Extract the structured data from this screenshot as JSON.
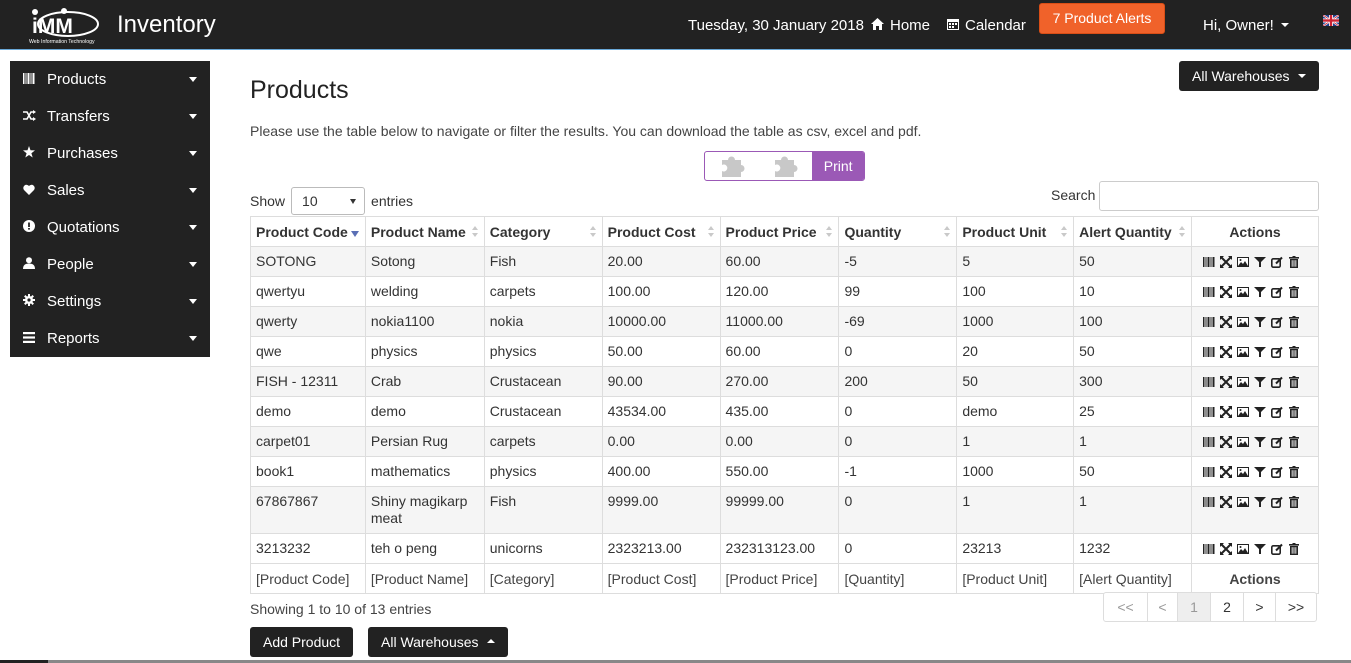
{
  "header": {
    "logo_text": "iMM",
    "logo_subtext": "Web Information Technology",
    "brand": "Inventory",
    "date": "Tuesday, 30 January 2018",
    "home_label": "Home",
    "calendar_label": "Calendar",
    "alerts_label": "7 Product Alerts",
    "user_label": "Hi, Owner!",
    "accent": "#f0622a"
  },
  "sidebar": {
    "items": [
      {
        "label": "Products",
        "icon": "barcode-icon"
      },
      {
        "label": "Transfers",
        "icon": "shuffle-icon"
      },
      {
        "label": "Purchases",
        "icon": "star-icon"
      },
      {
        "label": "Sales",
        "icon": "heart-icon"
      },
      {
        "label": "Quotations",
        "icon": "exclamation-circle-icon"
      },
      {
        "label": "People",
        "icon": "user-icon"
      },
      {
        "label": "Settings",
        "icon": "cog-icon"
      },
      {
        "label": "Reports",
        "icon": "list-icon"
      }
    ]
  },
  "main": {
    "title": "Products",
    "intro": "Please use the table below to navigate or filter the results. You can download the table as csv, excel and pdf.",
    "warehouse_button": "All Warehouses",
    "print_label": "Print",
    "show_label": "Show",
    "entries_value": "10",
    "entries_label": "entries",
    "search_label": "Search",
    "search_value": ""
  },
  "table": {
    "headers": [
      "Product Code",
      "Product Name",
      "Category",
      "Product Cost",
      "Product Price",
      "Quantity",
      "Product Unit",
      "Alert Quantity",
      "Actions"
    ],
    "rows": [
      [
        "SOTONG",
        "Sotong",
        "Fish",
        "20.00",
        "60.00",
        "-5",
        "5",
        "50"
      ],
      [
        "qwertyu",
        "welding",
        "carpets",
        "100.00",
        "120.00",
        "99",
        "100",
        "10"
      ],
      [
        "qwerty",
        "nokia1100",
        "nokia",
        "10000.00",
        "11000.00",
        "-69",
        "1000",
        "100"
      ],
      [
        "qwe",
        "physics",
        "physics",
        "50.00",
        "60.00",
        "0",
        "20",
        "50"
      ],
      [
        "FISH - 12311",
        "Crab",
        "Crustacean",
        "90.00",
        "270.00",
        "200",
        "50",
        "300"
      ],
      [
        "demo",
        "demo",
        "Crustacean",
        "43534.00",
        "435.00",
        "0",
        "demo",
        "25"
      ],
      [
        "carpet01",
        "Persian Rug",
        "carpets",
        "0.00",
        "0.00",
        "0",
        "1",
        "1"
      ],
      [
        "book1",
        "mathematics",
        "physics",
        "400.00",
        "550.00",
        "-1",
        "1000",
        "50"
      ],
      [
        "67867867",
        "Shiny magikarp meat",
        "Fish",
        "9999.00",
        "99999.00",
        "0",
        "1",
        "1"
      ],
      [
        "3213232",
        "teh o peng",
        "unicorns",
        "2323213.00",
        "232313123.00",
        "0",
        "23213",
        "1232"
      ]
    ],
    "footer": [
      "[Product Code]",
      "[Product Name]",
      "[Category]",
      "[Product Cost]",
      "[Product Price]",
      "[Quantity]",
      "[Product Unit]",
      "[Alert Quantity]",
      "Actions"
    ]
  },
  "pagination": {
    "info": "Showing 1 to 10 of 13 entries",
    "first": "<<",
    "prev": "<",
    "page1": "1",
    "page2": "2",
    "next": ">",
    "last": ">>"
  },
  "bottom": {
    "add_label": "Add Product",
    "warehouse_label": "All Warehouses"
  }
}
